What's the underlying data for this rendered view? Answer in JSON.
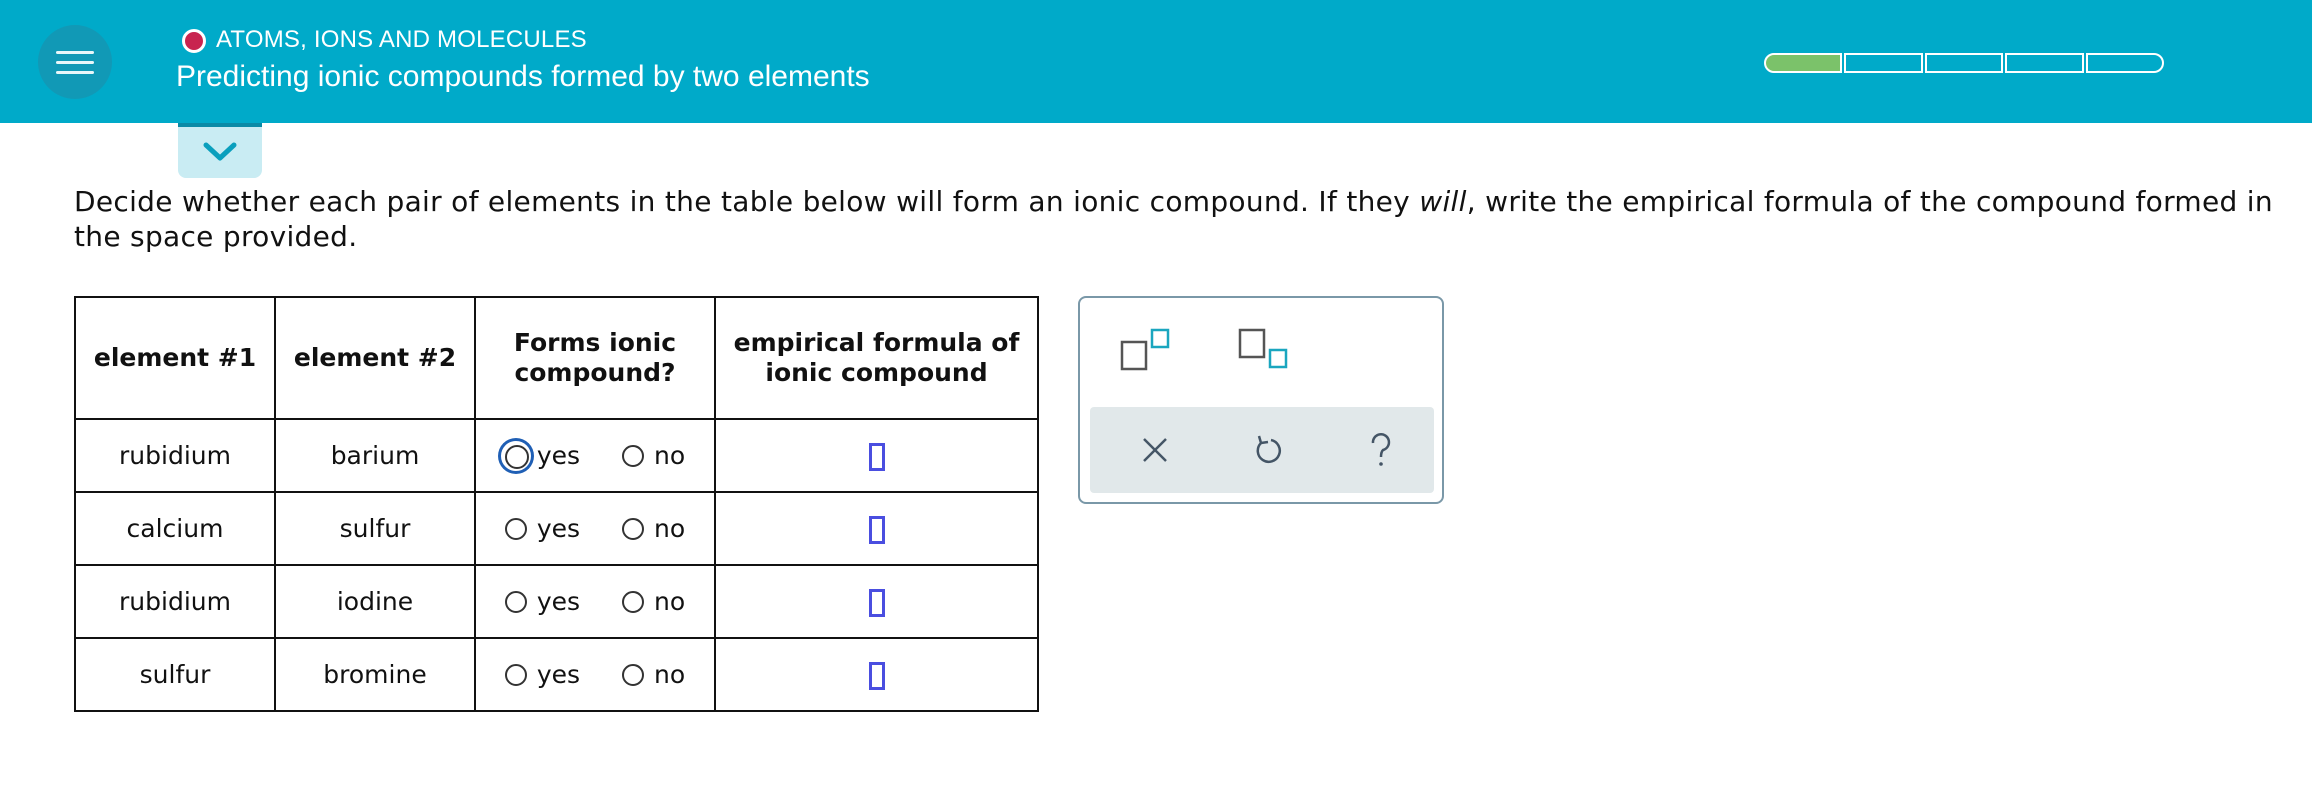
{
  "header": {
    "topic": "ATOMS, IONS AND MOLECULES",
    "title": "Predicting ionic compounds formed by two elements",
    "progress": {
      "total_segments": 5,
      "filled_segments": 1
    },
    "colors": {
      "bar": "#00aac9",
      "progress_fill": "#7bc26a",
      "topic_dot": "#c8244f"
    }
  },
  "icons": {
    "menu": "hamburger-icon",
    "collapse": "chevron-down-icon"
  },
  "instructions": {
    "before": "Decide whether each pair of elements in the table below will form an ionic compound. If they ",
    "emphasis": "will",
    "after": ", write the empirical formula of the compound formed in the space provided."
  },
  "table": {
    "headers": {
      "element1": "element #1",
      "element2": "element #2",
      "forms_line1": "Forms ionic",
      "forms_line2": "compound?",
      "formula_line1": "empirical formula of",
      "formula_line2": "ionic compound"
    },
    "yes_label": "yes",
    "no_label": "no",
    "rows": [
      {
        "element1": "rubidium",
        "element2": "barium",
        "selected": null,
        "formula": ""
      },
      {
        "element1": "calcium",
        "element2": "sulfur",
        "selected": null,
        "formula": ""
      },
      {
        "element1": "rubidium",
        "element2": "iodine",
        "selected": null,
        "formula": ""
      },
      {
        "element1": "sulfur",
        "element2": "bromine",
        "selected": null,
        "formula": ""
      }
    ]
  },
  "palette": {
    "tools": [
      "superscript-icon",
      "subscript-icon"
    ],
    "actions": [
      "close-icon",
      "undo-icon",
      "help-icon"
    ],
    "colors": {
      "accent": "#1aa6bf",
      "actions_bg": "#e1e8ea"
    }
  }
}
